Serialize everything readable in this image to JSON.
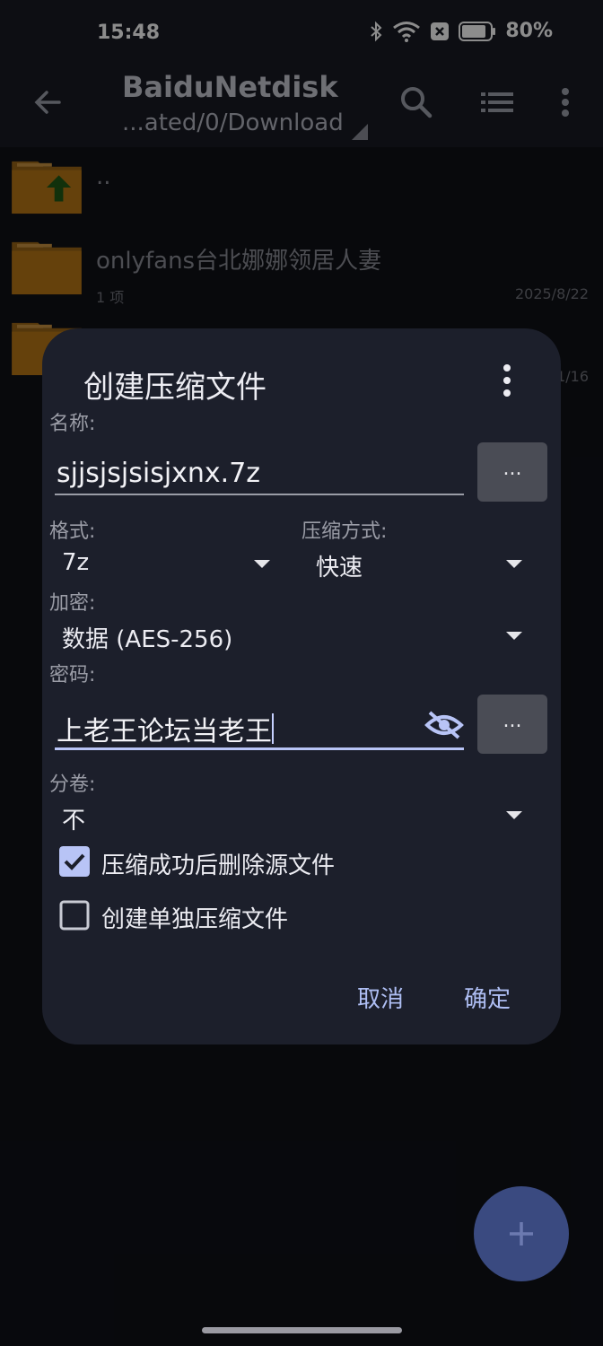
{
  "status_bar": {
    "time": "15:48",
    "battery": "80%",
    "icons": [
      "bluetooth-icon",
      "wifi-icon",
      "notification-x-icon",
      "battery-icon"
    ]
  },
  "toolbar": {
    "title": "BaiduNetdisk",
    "path": "...ated/0/Download",
    "icons": [
      "back-arrow-icon",
      "search-icon",
      "list-view-icon",
      "more-vert-icon"
    ]
  },
  "files": [
    {
      "name": "..",
      "meta": "",
      "date": ""
    },
    {
      "name": "onlyfans台北娜娜领居人妻",
      "meta": "1 项",
      "date": "2025/8/22"
    },
    {
      "name": "",
      "meta": "",
      "date": "1/16"
    }
  ],
  "dialog": {
    "title": "创建压缩文件",
    "name_label": "名称:",
    "name_value": "sjjsjsjsisjxnx.7z",
    "dots": "...",
    "format_label": "格式:",
    "format_value": "7z",
    "method_label": "压缩方式:",
    "method_value": "快速",
    "encrypt_label": "加密:",
    "encrypt_value": "数据 (AES-256)",
    "password_label": "密码:",
    "password_value": "上老王论坛当老王",
    "split_label": "分卷:",
    "split_value": "不",
    "checkbox1_label": "压缩成功后删除源文件",
    "checkbox1_checked": true,
    "checkbox2_label": "创建单独压缩文件",
    "checkbox2_checked": false,
    "cancel": "取消",
    "ok": "确定"
  },
  "colors": {
    "accent": "#aebef3",
    "checkbox": "#b8c4f6",
    "folder": "#c8811c",
    "fab": "#3a4a80"
  }
}
